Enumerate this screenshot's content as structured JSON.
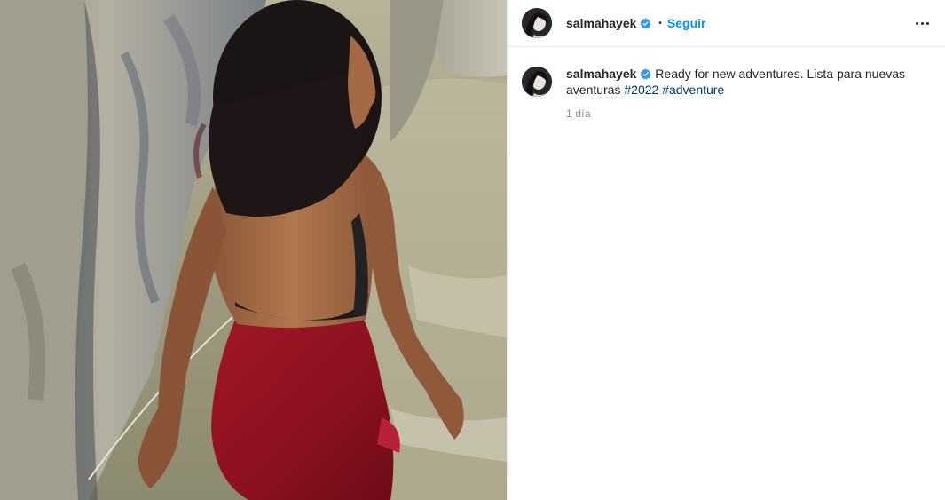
{
  "post": {
    "author": {
      "username": "salmahayek",
      "verified": true
    },
    "header": {
      "separator": "•",
      "follow_label": "Seguir",
      "more_icon": "more-horizontal-icon"
    },
    "caption": {
      "username": "salmahayek",
      "text": "Ready for new adventures. Lista para nuevas aventuras",
      "hashtags": [
        "#2022",
        "#adventure"
      ]
    },
    "timestamp": "1 día"
  },
  "colors": {
    "link_blue": "#0095f6",
    "hashtag": "#00376b",
    "verified_blue": "#3897f0",
    "muted": "#8e8e8e"
  }
}
